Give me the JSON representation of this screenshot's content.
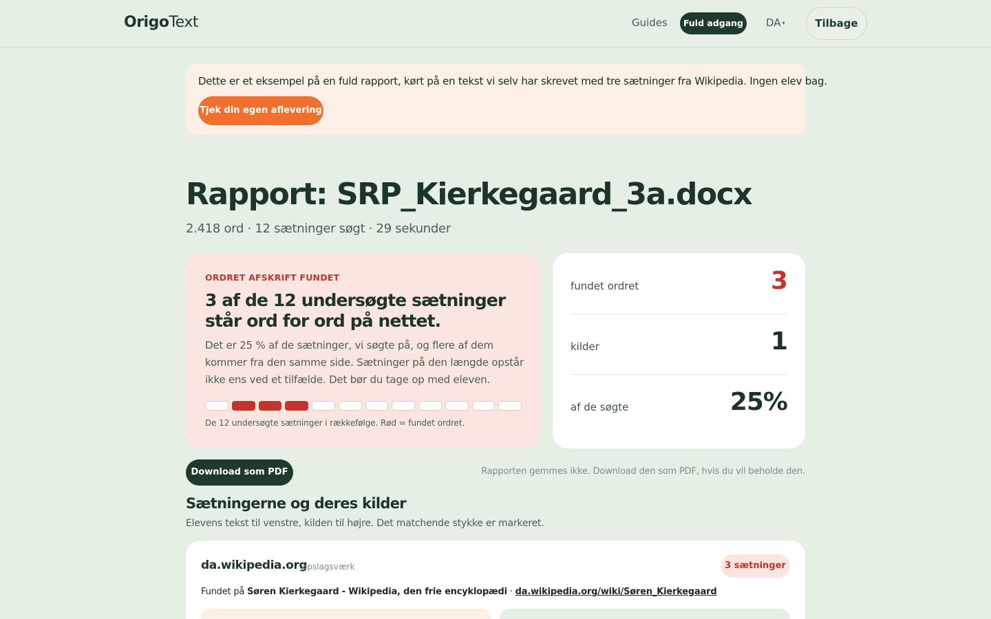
{
  "header": {
    "logo_bold": "Origo",
    "logo_light": "Text",
    "nav_guides": "Guides",
    "nav_full_access": "Fuld adgang",
    "nav_language": "DA",
    "nav_back": "Tilbage"
  },
  "banner": {
    "text": "Dette er et eksempel på en fuld rapport, kørt på en tekst vi selv har skrevet med tre sætninger fra Wikipedia. Ingen elev bag.",
    "button": "Tjek din egen aflevering"
  },
  "report": {
    "title": "Rapport: SRP_Kierkegaard_3a.docx",
    "meta": "2.418 ord · 12 sætninger søgt · 29 sekunder"
  },
  "result": {
    "kicker": "ORDRET AFSKRIFT FUNDET",
    "headline": "3 af de 12 undersøgte sætninger står ord for ord på nettet.",
    "body": "Det er 25 % af de sætninger, vi søgte på, og flere af dem kommer fra den samme side. Sætninger på den længde opstår ikke ens ved et tilfælde. Det bør du tage op med eleven.",
    "sentence_hits": [
      false,
      true,
      true,
      true,
      false,
      false,
      false,
      false,
      false,
      false,
      false,
      false
    ],
    "caption": "De 12 undersøgte sætninger i rækkefølge. Rød = fundet ordret.",
    "hit_color": "#c1362c"
  },
  "stats": [
    {
      "label": "fundet ordret",
      "value": "3"
    },
    {
      "label": "kilder",
      "value": "1"
    },
    {
      "label": "af de søgte",
      "value": "25%"
    }
  ],
  "download": {
    "button": "Download som PDF",
    "note": "Rapporten gemmes ikke. Download den som PDF, hvis du vil beholde den."
  },
  "sources_section": {
    "title": "Sætningerne og deres kilder",
    "subtitle": "Elevens tekst til venstre, kilden til højre. Det matchende stykke er markeret."
  },
  "source": {
    "domain": "da.wikipedia.org",
    "type": "opslagsværk",
    "badge": "3 sætninger",
    "found_prefix": "Fundet på",
    "page_title": "Søren Kierkegaard - Wikipedia, den frie encyklopædi",
    "separator": "·",
    "url": "da.wikipedia.org/wiki/Søren_Kierkegaard"
  },
  "colors": {
    "background": "#e6efe4",
    "brand_dark": "#1f3a2b",
    "accent_orange": "#f07030",
    "alert_red": "#c1362c"
  }
}
